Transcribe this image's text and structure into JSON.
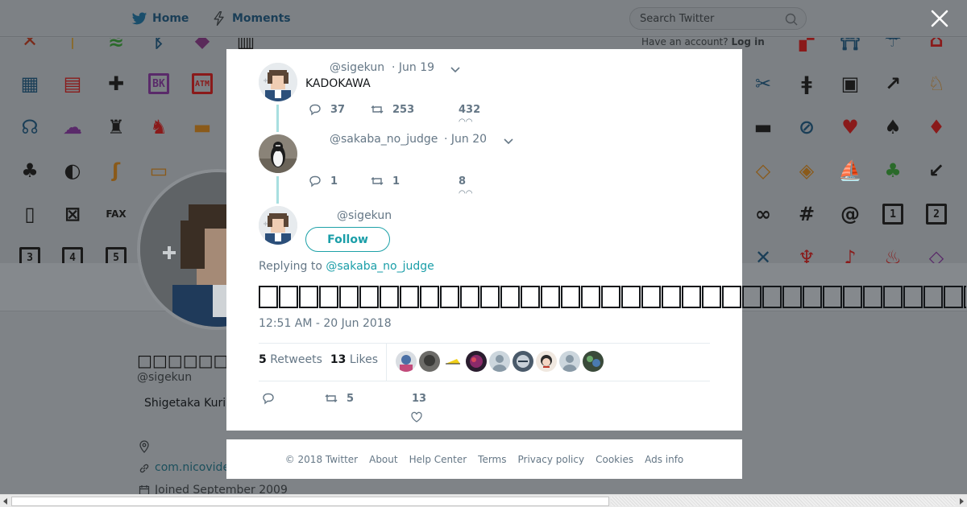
{
  "nav": {
    "home_label": "Home",
    "moments_label": "Moments",
    "search_placeholder": "Search Twitter",
    "have_account_text": "Have an account?",
    "login_label": "Log in"
  },
  "profile": {
    "name": "□□□□□□□□□□□□□",
    "handle": "@sigekun",
    "bio": "Shigetaka Kuri",
    "link": "com.nicovide",
    "joined": "Joined September 2009"
  },
  "modal": {
    "thread": [
      {
        "handle": "@sigekun",
        "date": "· Jun 19",
        "text": "KADOKAWA",
        "replies": "37",
        "retweets": "253",
        "likes": "432"
      },
      {
        "handle": "@sakaba_no_judge",
        "date": "· Jun 20",
        "text": "",
        "replies": "1",
        "retweets": "1",
        "likes": "8"
      }
    ],
    "main_tweet": {
      "handle": "@sigekun",
      "follow_label": "Follow",
      "replying_prefix": "Replying to",
      "replying_to": "@sakaba_no_judge",
      "text": "□□□□□□□□□□□□□□□□□□□□□□□□□□□□□□□□□□□□",
      "timestamp": "12:51 AM - 20 Jun 2018",
      "retweets_count": "5",
      "retweets_label": "Retweets",
      "likes_count": "13",
      "likes_label": "Likes",
      "action_retweets": "5",
      "action_likes": "13"
    }
  },
  "footer": {
    "links": [
      "© 2018 Twitter",
      "About",
      "Help Center",
      "Terms",
      "Privacy policy",
      "Cookies",
      "Ads info"
    ]
  },
  "colors": {
    "accent": "#1da1a8",
    "overlay_bg": "#7f8387",
    "thread_line": "#a8dfe0"
  }
}
